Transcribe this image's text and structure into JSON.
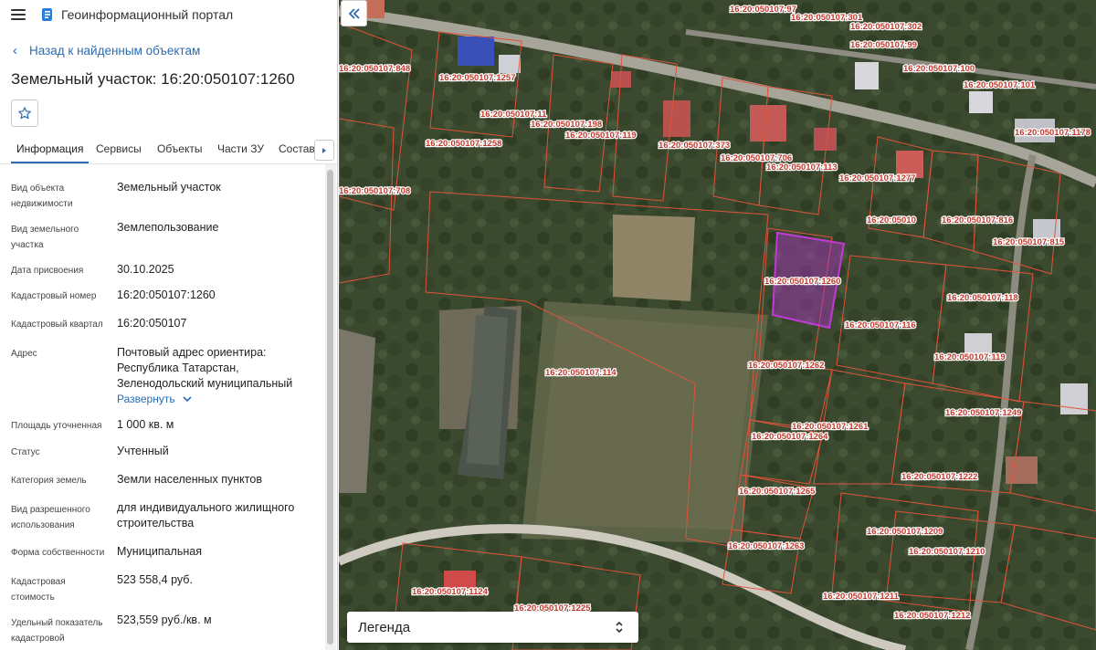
{
  "header": {
    "app_title": "Геоинформационный портал"
  },
  "nav": {
    "back_label": "Назад к найденным объектам"
  },
  "object": {
    "title": "Земельный участок: 16:20:050107:1260"
  },
  "tabs": [
    "Информация",
    "Сервисы",
    "Объекты",
    "Части ЗУ",
    "Состав"
  ],
  "properties": [
    {
      "label": "Вид объекта недвижимости",
      "value": "Земельный участок"
    },
    {
      "label": "Вид земельного участка",
      "value": "Землепользование"
    },
    {
      "label": "Дата присвоения",
      "value": "30.10.2025"
    },
    {
      "label": "Кадастровый номер",
      "value": "16:20:050107:1260"
    },
    {
      "label": "Кадастровый квартал",
      "value": "16:20:050107"
    },
    {
      "label": "Адрес",
      "value": "Почтовый адрес ориентира: Республика Татарстан, Зеленодольский муниципальный",
      "expand_label": "Развернуть"
    },
    {
      "label": "Площадь уточненная",
      "value": "1 000 кв. м"
    },
    {
      "label": "Статус",
      "value": "Учтенный"
    },
    {
      "label": "Категория земель",
      "value": "Земли населенных пунктов"
    },
    {
      "label": "Вид разрешенного использования",
      "value": "для индивидуального жилищного строительства"
    },
    {
      "label": "Форма собственности",
      "value": "Муниципальная"
    },
    {
      "label": "Кадастровая стоимость",
      "value": "523 558,4 руб."
    },
    {
      "label": "Удельный показатель кадастровой",
      "value": "523,559 руб./кв. м"
    }
  ],
  "map": {
    "legend_label": "Легенда",
    "parcel_labels": [
      "16:20:050107:97",
      "16:20:050107:301",
      "16:20:050107:302",
      "16:20:050107:99",
      "16:20:050107:848",
      "16:20:050107:1257",
      "16:20:050107:100",
      "16:20:050107:101",
      "16:20:050107:11",
      "16:20:050107:198",
      "16:20:050107:119",
      "16:20:050107:1258",
      "16:20:050107:373",
      "16:20:050107:706",
      "16:20:050107:113",
      "16:20:050107:1277",
      "16:20:050107:1178",
      "16:20:050107:708",
      "16:20:05010",
      "16:20:050107:816",
      "16:20:050107:815",
      "16:20:050107:1260",
      "16:20:050107:118",
      "16:20:050107:116",
      "16:20:050107:114",
      "16:20:050107:1262",
      "16:20:050107:119",
      "16:20:050107:1249",
      "16:20:050107:1261",
      "16:20:050107:1264",
      "16:20:050107:1222",
      "16:20:050107:1265",
      "16:20:050107:1209",
      "16:20:050107:1263",
      "16:20:050107:1210",
      "16:20:050107:1124",
      "16:20:050107:1225",
      "16:20:050107:1211",
      "16:20:050107:1212"
    ],
    "colors": {
      "parcel_border": "#e0533a",
      "selected_parcel": "#c23ad6",
      "label_text": "#c0392b"
    }
  }
}
